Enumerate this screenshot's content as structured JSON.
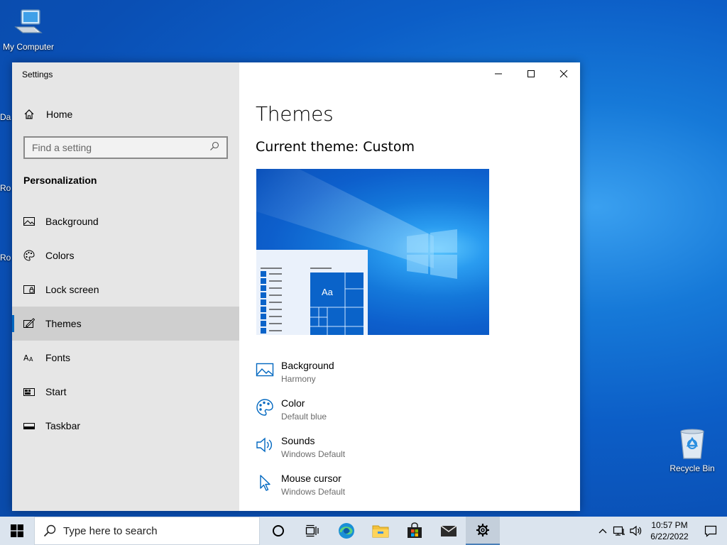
{
  "desktop": {
    "icons": [
      {
        "label": "My Computer"
      },
      {
        "label": "Recycle Bin"
      }
    ],
    "partial_labels": [
      "Da",
      "Ro",
      "Ro"
    ]
  },
  "window": {
    "title": "Settings",
    "sidebar": {
      "home_label": "Home",
      "search_placeholder": "Find a setting",
      "section_title": "Personalization",
      "items": [
        {
          "label": "Background",
          "icon": "picture-icon"
        },
        {
          "label": "Colors",
          "icon": "palette-icon"
        },
        {
          "label": "Lock screen",
          "icon": "lock-screen-icon"
        },
        {
          "label": "Themes",
          "icon": "themes-icon",
          "active": true
        },
        {
          "label": "Fonts",
          "icon": "fonts-icon"
        },
        {
          "label": "Start",
          "icon": "start-icon"
        },
        {
          "label": "Taskbar",
          "icon": "taskbar-icon"
        }
      ]
    },
    "main": {
      "title": "Themes",
      "current_theme": "Current theme: Custom",
      "preview_tile_text": "Aa",
      "properties": [
        {
          "label": "Background",
          "value": "Harmony",
          "icon": "picture-icon"
        },
        {
          "label": "Color",
          "value": "Default blue",
          "icon": "palette-icon"
        },
        {
          "label": "Sounds",
          "value": "Windows Default",
          "icon": "speaker-icon"
        },
        {
          "label": "Mouse cursor",
          "value": "Windows Default",
          "icon": "cursor-icon"
        }
      ]
    }
  },
  "taskbar": {
    "search_placeholder": "Type here to search",
    "time": "10:57 PM",
    "date": "6/22/2022"
  },
  "colors": {
    "accent": "#0067c0",
    "sidebar_bg": "#e6e6e6",
    "active_item_bg": "#cfcfcf",
    "taskbar_bg": "#dbe4ee"
  }
}
